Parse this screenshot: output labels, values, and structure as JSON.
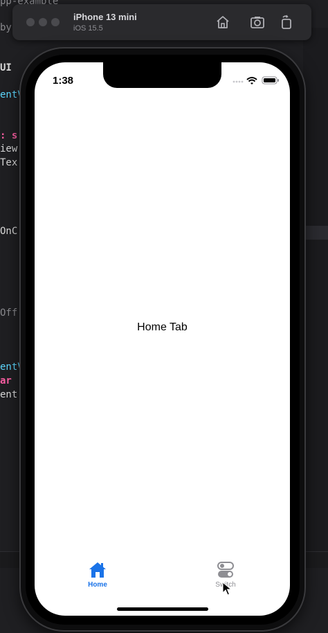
{
  "editor": {
    "lines": [
      {
        "text": "pp-example",
        "color": "#8a8a8e"
      },
      {
        "text": "by",
        "color": "#8a8a8e"
      },
      {
        "text": "UI",
        "color": "#d9d9d9"
      },
      {
        "text": "entV",
        "color": "#5dd8ff"
      },
      {
        "text": ": s",
        "color": "#fc5fa3"
      },
      {
        "text": "iew",
        "color": "#d9d9d9"
      },
      {
        "text": "Tex",
        "color": "#d9d9d9"
      },
      {
        "text": "OnC",
        "color": "#d9d9d9"
      },
      {
        "text": "Off",
        "color": "#8a8a8e"
      },
      {
        "text": "entV",
        "color": "#5dd8ff"
      },
      {
        "text": "ar",
        "color": "#fc5fa3"
      },
      {
        "text": "ent",
        "color": "#d9d9d9"
      }
    ]
  },
  "simulator": {
    "device_name": "iPhone 13 mini",
    "os_version": "iOS 15.5",
    "toolbar_icons": [
      "home-icon",
      "screenshot-icon",
      "rotate-icon"
    ]
  },
  "status_bar": {
    "time": "1:38",
    "icons": [
      "signal-icon",
      "wifi-icon",
      "battery-icon"
    ]
  },
  "content": {
    "title": "Home Tab"
  },
  "tabbar": {
    "tabs": [
      {
        "label": "Home",
        "icon": "house-icon",
        "selected": true
      },
      {
        "label": "Switch",
        "icon": "switch-icon",
        "selected": false
      }
    ]
  },
  "colors": {
    "accent": "#1a73e8",
    "inactive": "#8e8e93"
  }
}
